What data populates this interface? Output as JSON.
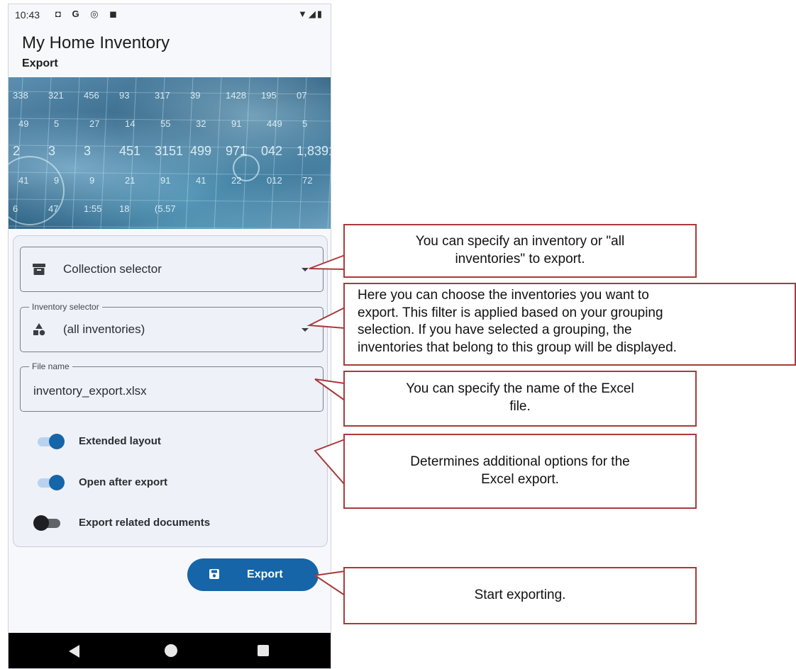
{
  "status_bar": {
    "time": "10:43",
    "left_icons": "◘ G ◎ ◼",
    "right_icons": "▼◢▮"
  },
  "app": {
    "title": "My Home Inventory",
    "subtitle": "Export"
  },
  "hero": {
    "numbers": [
      "338",
      "321",
      "456",
      "93",
      "317",
      "39",
      "1428",
      "195",
      "07",
      "49",
      "5",
      "27",
      "14",
      "55",
      "32",
      "91",
      "449",
      "5",
      "2",
      "3",
      "3",
      "451",
      "3151",
      "499",
      "971",
      "042",
      "1,8391",
      "41",
      "9",
      "9",
      "21",
      "91",
      "41",
      "22",
      "012",
      "72",
      "6",
      "47",
      "1:55",
      "18",
      "(5.57"
    ]
  },
  "form": {
    "collection_selector": {
      "label": "Collection selector",
      "icon": "archive-icon"
    },
    "inventory_selector": {
      "legend": "Inventory selector",
      "value": "(all inventories)",
      "icon": "shapes-icon"
    },
    "file_name": {
      "legend": "File name",
      "value": "inventory_export.xlsx"
    },
    "toggles": [
      {
        "label": "Extended layout",
        "on": true
      },
      {
        "label": "Open after export",
        "on": true
      },
      {
        "label": "Export related documents",
        "on": false
      }
    ],
    "export_button": {
      "label": "Export",
      "icon": "save-icon"
    }
  },
  "callouts": [
    {
      "lines": [
        "You can specify an inventory or \"all",
        "inventories\" to export."
      ]
    },
    {
      "lines": [
        "Here you can choose the inventories you want to",
        "export. This filter is applied based on your grouping",
        "selection. If you have selected a grouping, the",
        "inventories that belong to this group will be displayed."
      ]
    },
    {
      "lines": [
        "You can specify the name of the Excel",
        "file."
      ]
    },
    {
      "lines": [
        "Determines additional options for the",
        "Excel export."
      ]
    },
    {
      "lines": [
        "Start exporting."
      ]
    }
  ],
  "colors": {
    "accent": "#1565a8",
    "callout_border": "#a83a3a"
  }
}
